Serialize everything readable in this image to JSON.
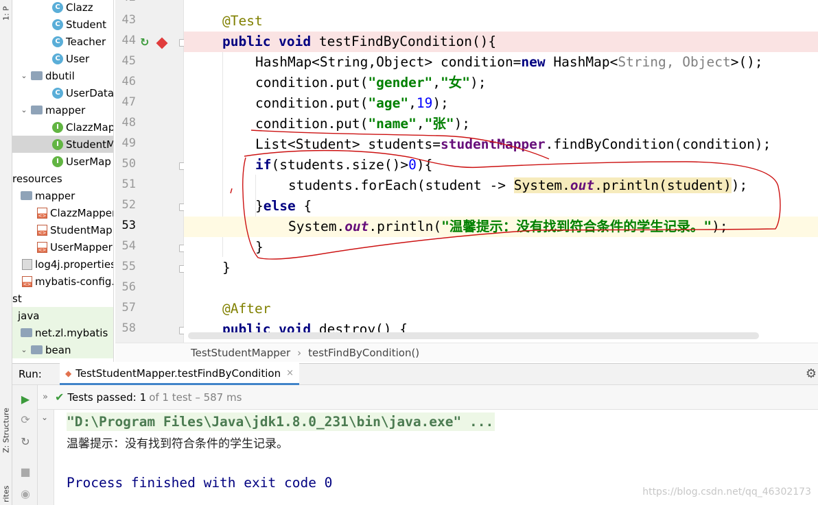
{
  "tool_strip": {
    "top_tab": "1: P",
    "structure_tab": "Z: Structure",
    "favorites_tab": "rites"
  },
  "project_tree": [
    {
      "label": "Clazz",
      "icon": "class-icon",
      "indent": 58,
      "chevron": ""
    },
    {
      "label": "Student",
      "icon": "class-icon",
      "indent": 58,
      "chevron": ""
    },
    {
      "label": "Teacher",
      "icon": "class-icon",
      "indent": 58,
      "chevron": ""
    },
    {
      "label": "User",
      "icon": "class-icon",
      "indent": 58,
      "chevron": ""
    },
    {
      "label": "dbutil",
      "icon": "folder-icon",
      "indent": 10,
      "chevron": "⌄"
    },
    {
      "label": "UserData",
      "icon": "class-icon",
      "indent": 58,
      "chevron": ""
    },
    {
      "label": "mapper",
      "icon": "folder-icon",
      "indent": 10,
      "chevron": "⌄"
    },
    {
      "label": "ClazzMap",
      "icon": "interface-icon",
      "indent": 58,
      "chevron": ""
    },
    {
      "label": "StudentM",
      "icon": "interface-icon",
      "indent": 58,
      "chevron": "",
      "selected": true
    },
    {
      "label": "UserMap",
      "icon": "interface-icon",
      "indent": 58,
      "chevron": ""
    },
    {
      "label": "resources",
      "icon": "",
      "indent": 0,
      "chevron": ""
    },
    {
      "label": "mapper",
      "icon": "folder-icon",
      "indent": 12,
      "chevron": ""
    },
    {
      "label": "ClazzMapper",
      "icon": "xml-icon",
      "indent": 36,
      "chevron": ""
    },
    {
      "label": "StudentMap",
      "icon": "xml-icon",
      "indent": 36,
      "chevron": ""
    },
    {
      "label": "UserMapper",
      "icon": "xml-icon",
      "indent": 36,
      "chevron": ""
    },
    {
      "label": "log4j.properties",
      "icon": "properties-icon",
      "indent": 14,
      "chevron": ""
    },
    {
      "label": "mybatis-config.:",
      "icon": "xml-icon",
      "indent": 14,
      "chevron": ""
    },
    {
      "label": "st",
      "icon": "",
      "indent": 0,
      "chevron": ""
    },
    {
      "label": "java",
      "icon": "",
      "indent": 8,
      "chevron": "",
      "green": true
    },
    {
      "label": "net.zl.mybatis",
      "icon": "folder-icon",
      "indent": 12,
      "chevron": "",
      "green": true
    },
    {
      "label": "bean",
      "icon": "folder-icon",
      "indent": 10,
      "chevron": "⌄",
      "green": true
    }
  ],
  "editor": {
    "first_line_partial": "42",
    "line_numbers": [
      "43",
      "44",
      "45",
      "46",
      "47",
      "48",
      "49",
      "50",
      "51",
      "52",
      "53",
      "54",
      "55",
      "56",
      "57",
      "58"
    ],
    "breakpoint_line": "44",
    "current_line": "53"
  },
  "breadcrumb": {
    "class_name": "TestStudentMapper",
    "separator": "›",
    "method_name": "testFindByCondition()"
  },
  "run_panel": {
    "label": "Run:",
    "tab_title": "TestStudentMapper.testFindByCondition",
    "tab_close": "×",
    "tests_passed_label": "Tests passed:",
    "passed_count": "1",
    "total_text": "of 1 test – 587 ms"
  },
  "console": {
    "java_cmd": "\"D:\\Program Files\\Java\\jdk1.8.0_231\\bin\\java.exe\" ...",
    "output": "温馨提示：没有找到符合条件的学生记录。",
    "exit_message": "Process finished with exit code 0"
  },
  "watermark": "https://blog.csdn.net/qq_46302173",
  "colors": {
    "keyword": "#000080",
    "string": "#008000",
    "annotation": "#808000",
    "breakpoint": "#e03c3c",
    "ink": "#cc1111"
  }
}
